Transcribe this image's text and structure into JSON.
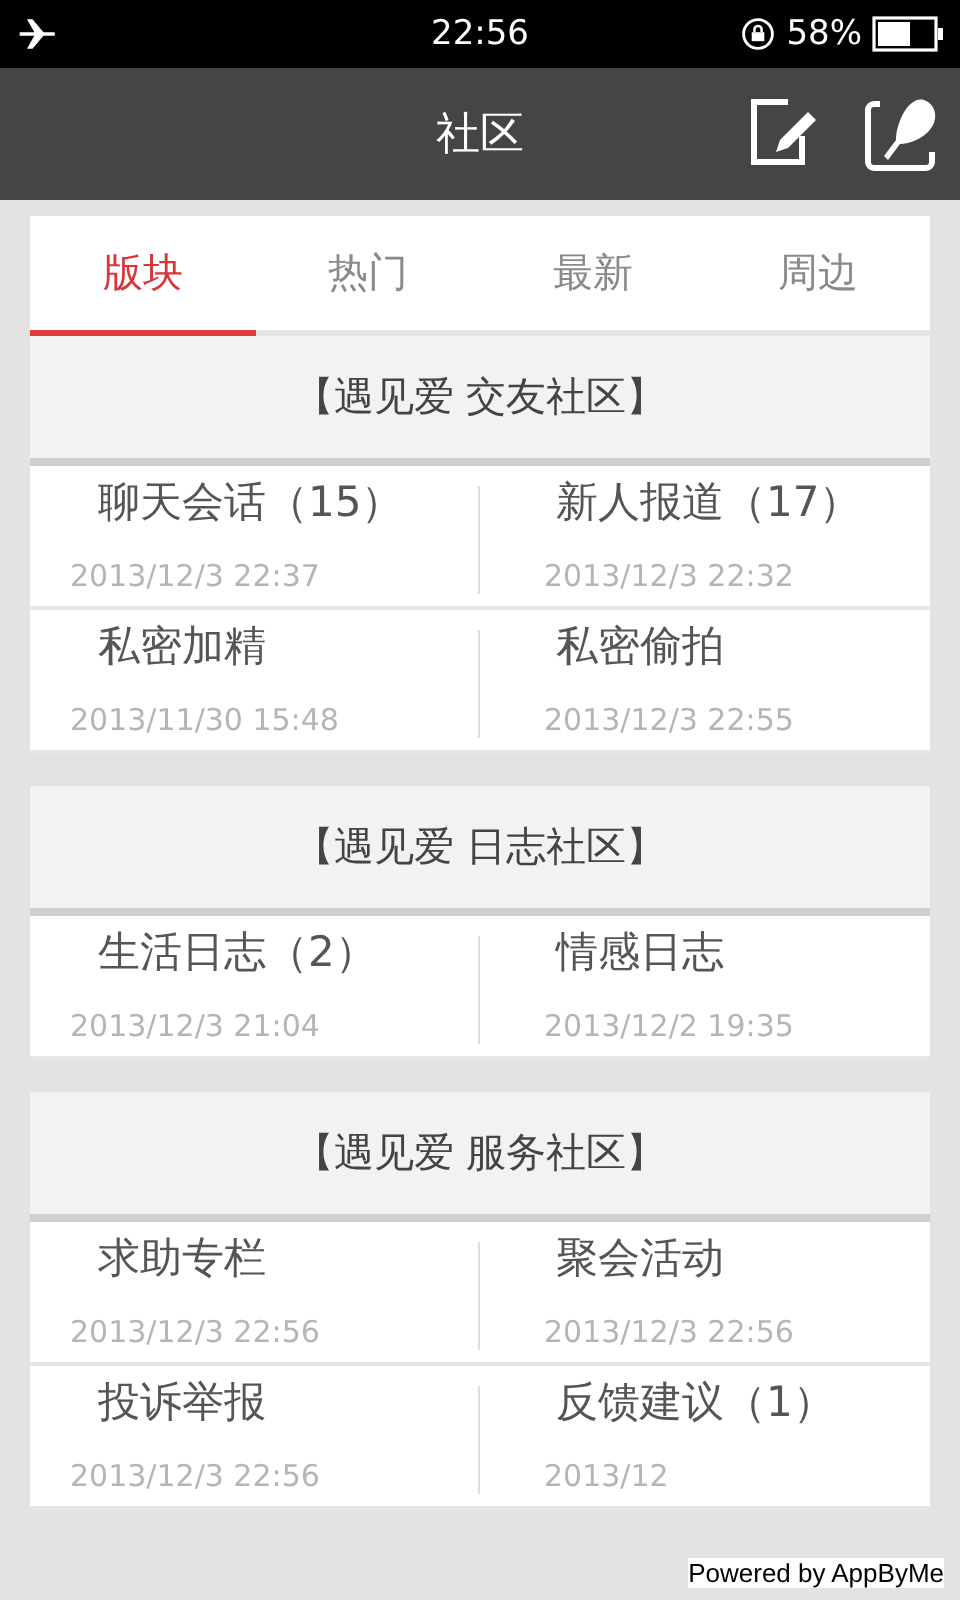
{
  "status_bar": {
    "time": "22:56",
    "battery": "58%"
  },
  "header": {
    "title": "社区"
  },
  "tabs": [
    {
      "label": "版块",
      "selected": true
    },
    {
      "label": "热门",
      "selected": false
    },
    {
      "label": "最新",
      "selected": false
    },
    {
      "label": "周边",
      "selected": false
    }
  ],
  "sections": [
    {
      "title": "【遇见爱 交友社区】",
      "boards": [
        {
          "name": "聊天会话",
          "count": "（15）",
          "time": "2013/12/3 22:37"
        },
        {
          "name": "新人报道",
          "count": "（17）",
          "time": "2013/12/3 22:32"
        },
        {
          "name": "私密加精",
          "time": "2013/11/30 15:48"
        },
        {
          "name": "私密偷拍",
          "time": "2013/12/3 22:55"
        }
      ]
    },
    {
      "title": "【遇见爱 日志社区】",
      "boards": [
        {
          "name": "生活日志",
          "count": "（2）",
          "time": "2013/12/3 21:04"
        },
        {
          "name": "情感日志",
          "time": "2013/12/2 19:35"
        }
      ]
    },
    {
      "title": "【遇见爱 服务社区】",
      "boards": [
        {
          "name": "求助专栏",
          "time": "2013/12/3 22:56"
        },
        {
          "name": "聚会活动",
          "time": "2013/12/3 22:56"
        },
        {
          "name": "投诉举报",
          "time": "2013/12/3 22:56"
        },
        {
          "name": "反馈建议",
          "count": "（1）",
          "time": "2013/12"
        }
      ]
    }
  ],
  "footer": {
    "credit": "Powered by AppByMe"
  }
}
